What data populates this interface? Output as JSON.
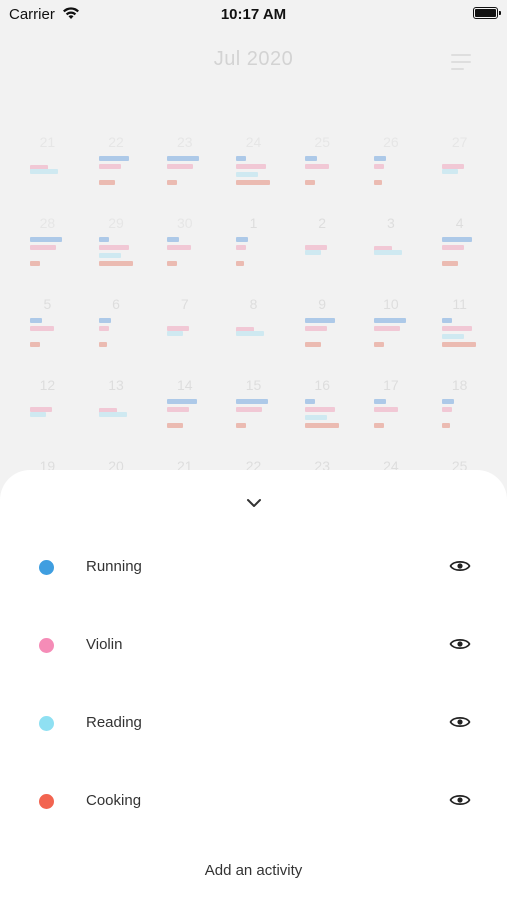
{
  "status_bar": {
    "carrier": "Carrier",
    "time": "10:17 AM"
  },
  "calendar": {
    "title": "Jul 2020",
    "weeks": [
      [
        "21",
        "22",
        "23",
        "24",
        "25",
        "26",
        "27"
      ],
      [
        "28",
        "29",
        "30",
        "1",
        "2",
        "3",
        "4"
      ],
      [
        "5",
        "6",
        "7",
        "8",
        "9",
        "10",
        "11"
      ],
      [
        "12",
        "13",
        "14",
        "15",
        "16",
        "17",
        "18"
      ],
      [
        "19",
        "20",
        "21",
        "22",
        "23",
        "24",
        "25"
      ]
    ]
  },
  "activities": [
    {
      "name": "Running",
      "color": "#3f9ee0",
      "icon": "eye-icon"
    },
    {
      "name": "Violin",
      "color": "#f58cb7",
      "icon": "eye-icon"
    },
    {
      "name": "Reading",
      "color": "#8fe0f2",
      "icon": "eye-icon"
    },
    {
      "name": "Cooking",
      "color": "#f26450",
      "icon": "eye-icon"
    }
  ],
  "add_activity_label": "Add an activity"
}
